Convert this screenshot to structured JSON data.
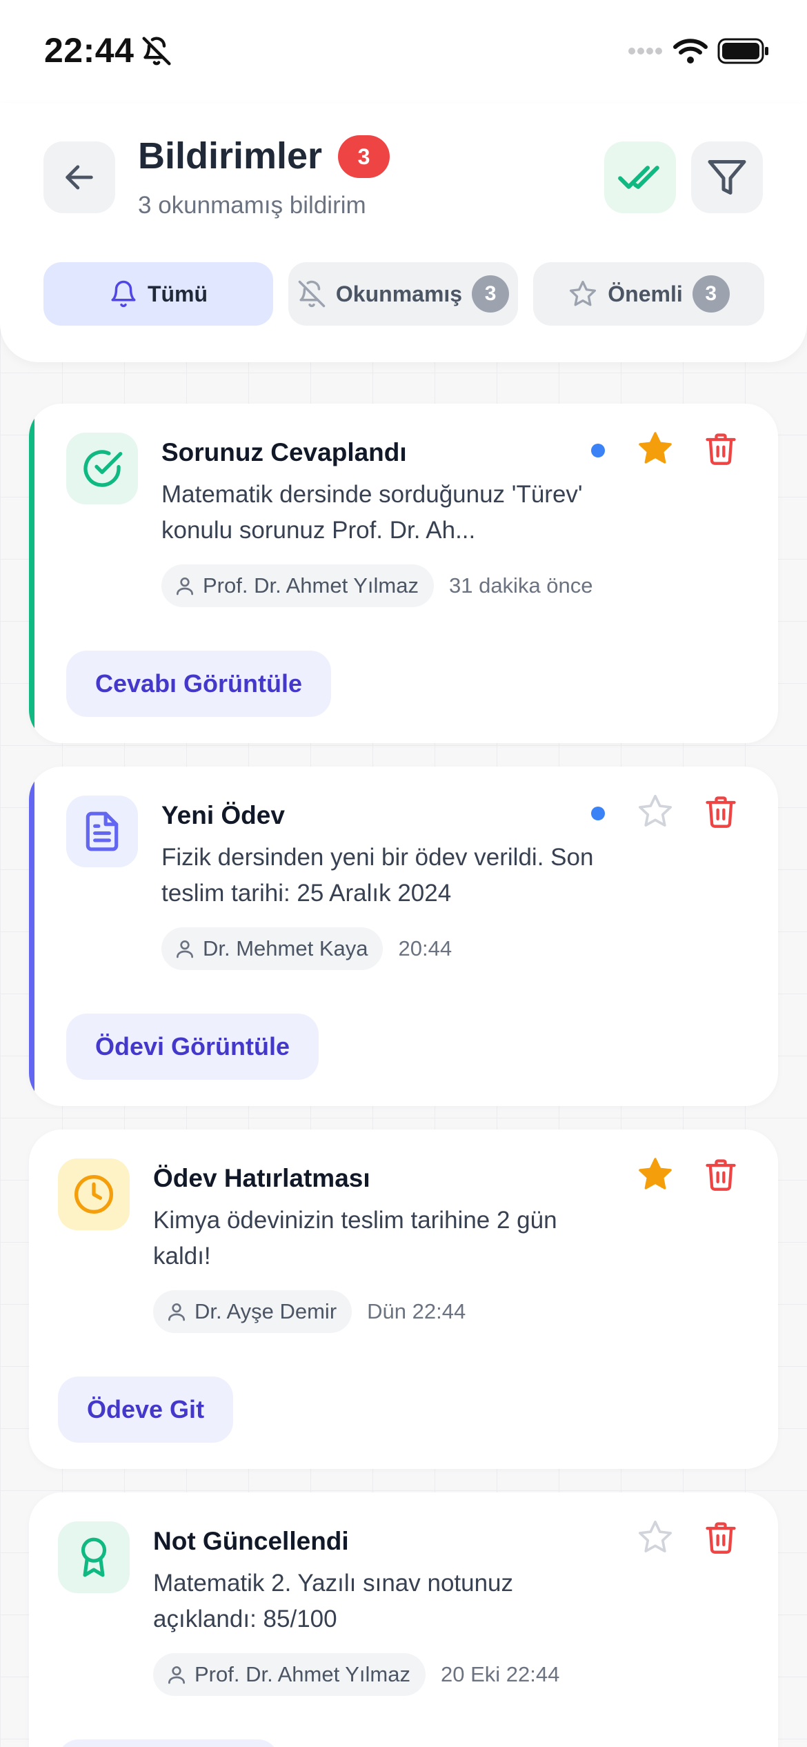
{
  "status_bar": {
    "time": "22:44"
  },
  "header": {
    "title": "Bildirimler",
    "unread_badge": "3",
    "subtitle": "3 okunmamış bildirim"
  },
  "tabs": [
    {
      "label": "Tümü",
      "count": "",
      "active": true,
      "icon": "bell-icon"
    },
    {
      "label": "Okunmamış",
      "count": "3",
      "active": false,
      "icon": "bell-off-icon"
    },
    {
      "label": "Önemli",
      "count": "3",
      "active": false,
      "icon": "star-outline-icon"
    }
  ],
  "notifications": [
    {
      "title": "Sorunuz Cevaplandı",
      "message": "Matematik dersinde sorduğunuz 'Türev' konulu sorunuz Prof. Dr. Ah...",
      "author": "Prof. Dr. Ahmet Yılmaz",
      "time": "31 dakika önce",
      "action": "Cevabı Görüntüle",
      "unread": true,
      "starred": true,
      "icon": "check-circle-icon",
      "accent_color": "#10b981"
    },
    {
      "title": "Yeni Ödev",
      "message": "Fizik dersinden yeni bir ödev verildi. Son teslim tarihi: 25 Aralık 2024",
      "author": "Dr. Mehmet Kaya",
      "time": "20:44",
      "action": "Ödevi Görüntüle",
      "unread": true,
      "starred": false,
      "icon": "document-icon",
      "accent_color": "#6366f1"
    },
    {
      "title": "Ödev Hatırlatması",
      "message": "Kimya ödevinizin teslim tarihine 2 gün kaldı!",
      "author": "Dr. Ayşe Demir",
      "time": "Dün 22:44",
      "action": "Ödeve Git",
      "unread": false,
      "starred": true,
      "icon": "clock-icon",
      "accent_color": ""
    },
    {
      "title": "Not Güncellendi",
      "message": "Matematik 2. Yazılı sınav notunuz açıklandı: 85/100",
      "author": "Prof. Dr. Ahmet Yılmaz",
      "time": "20 Eki 22:44",
      "action": "",
      "unread": false,
      "starred": false,
      "icon": "award-icon",
      "accent_color": ""
    }
  ],
  "colors": {
    "brand": "#4338ca",
    "danger": "#ef4444",
    "star": "#f59e0b",
    "success": "#10b981",
    "accent_purple": "#6366f1"
  }
}
